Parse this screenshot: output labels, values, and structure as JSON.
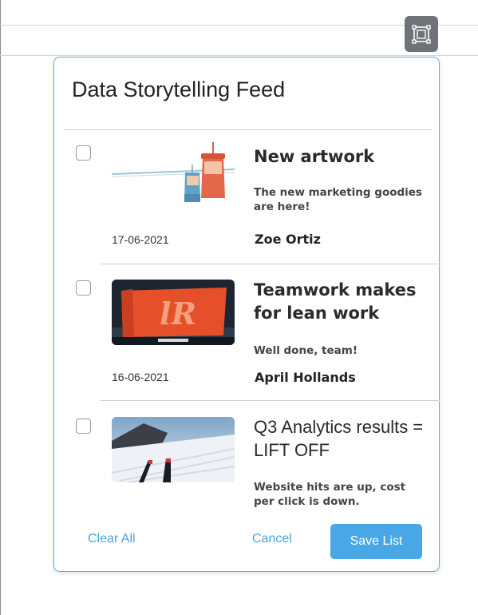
{
  "dialog": {
    "title": "Data Storytelling Feed"
  },
  "items": [
    {
      "date": "17-06-2021",
      "headline": "New artwork",
      "description": "The new marketing goodies are here!",
      "author": "Zoe Ortiz",
      "image": "gondola-illustration"
    },
    {
      "date": "16-06-2021",
      "headline": "Teamwork makes for lean work",
      "description": "Well done, team!",
      "author": "April Hollands",
      "image": "team-banner-photo"
    },
    {
      "date": "",
      "headline": "Q3 Analytics results = LIFT OFF",
      "description": "Website hits are up, cost per click is down.",
      "author": "",
      "image": "ski-slope-photo"
    }
  ],
  "actions": {
    "clear_all": "Clear All",
    "cancel": "Cancel",
    "save": "Save List"
  },
  "colors": {
    "accent": "#48a7e6",
    "dialog_border": "#6fa7d8",
    "toolbar_button": "#6f7378"
  },
  "icons": {
    "toolbar": "frame-select-icon"
  }
}
